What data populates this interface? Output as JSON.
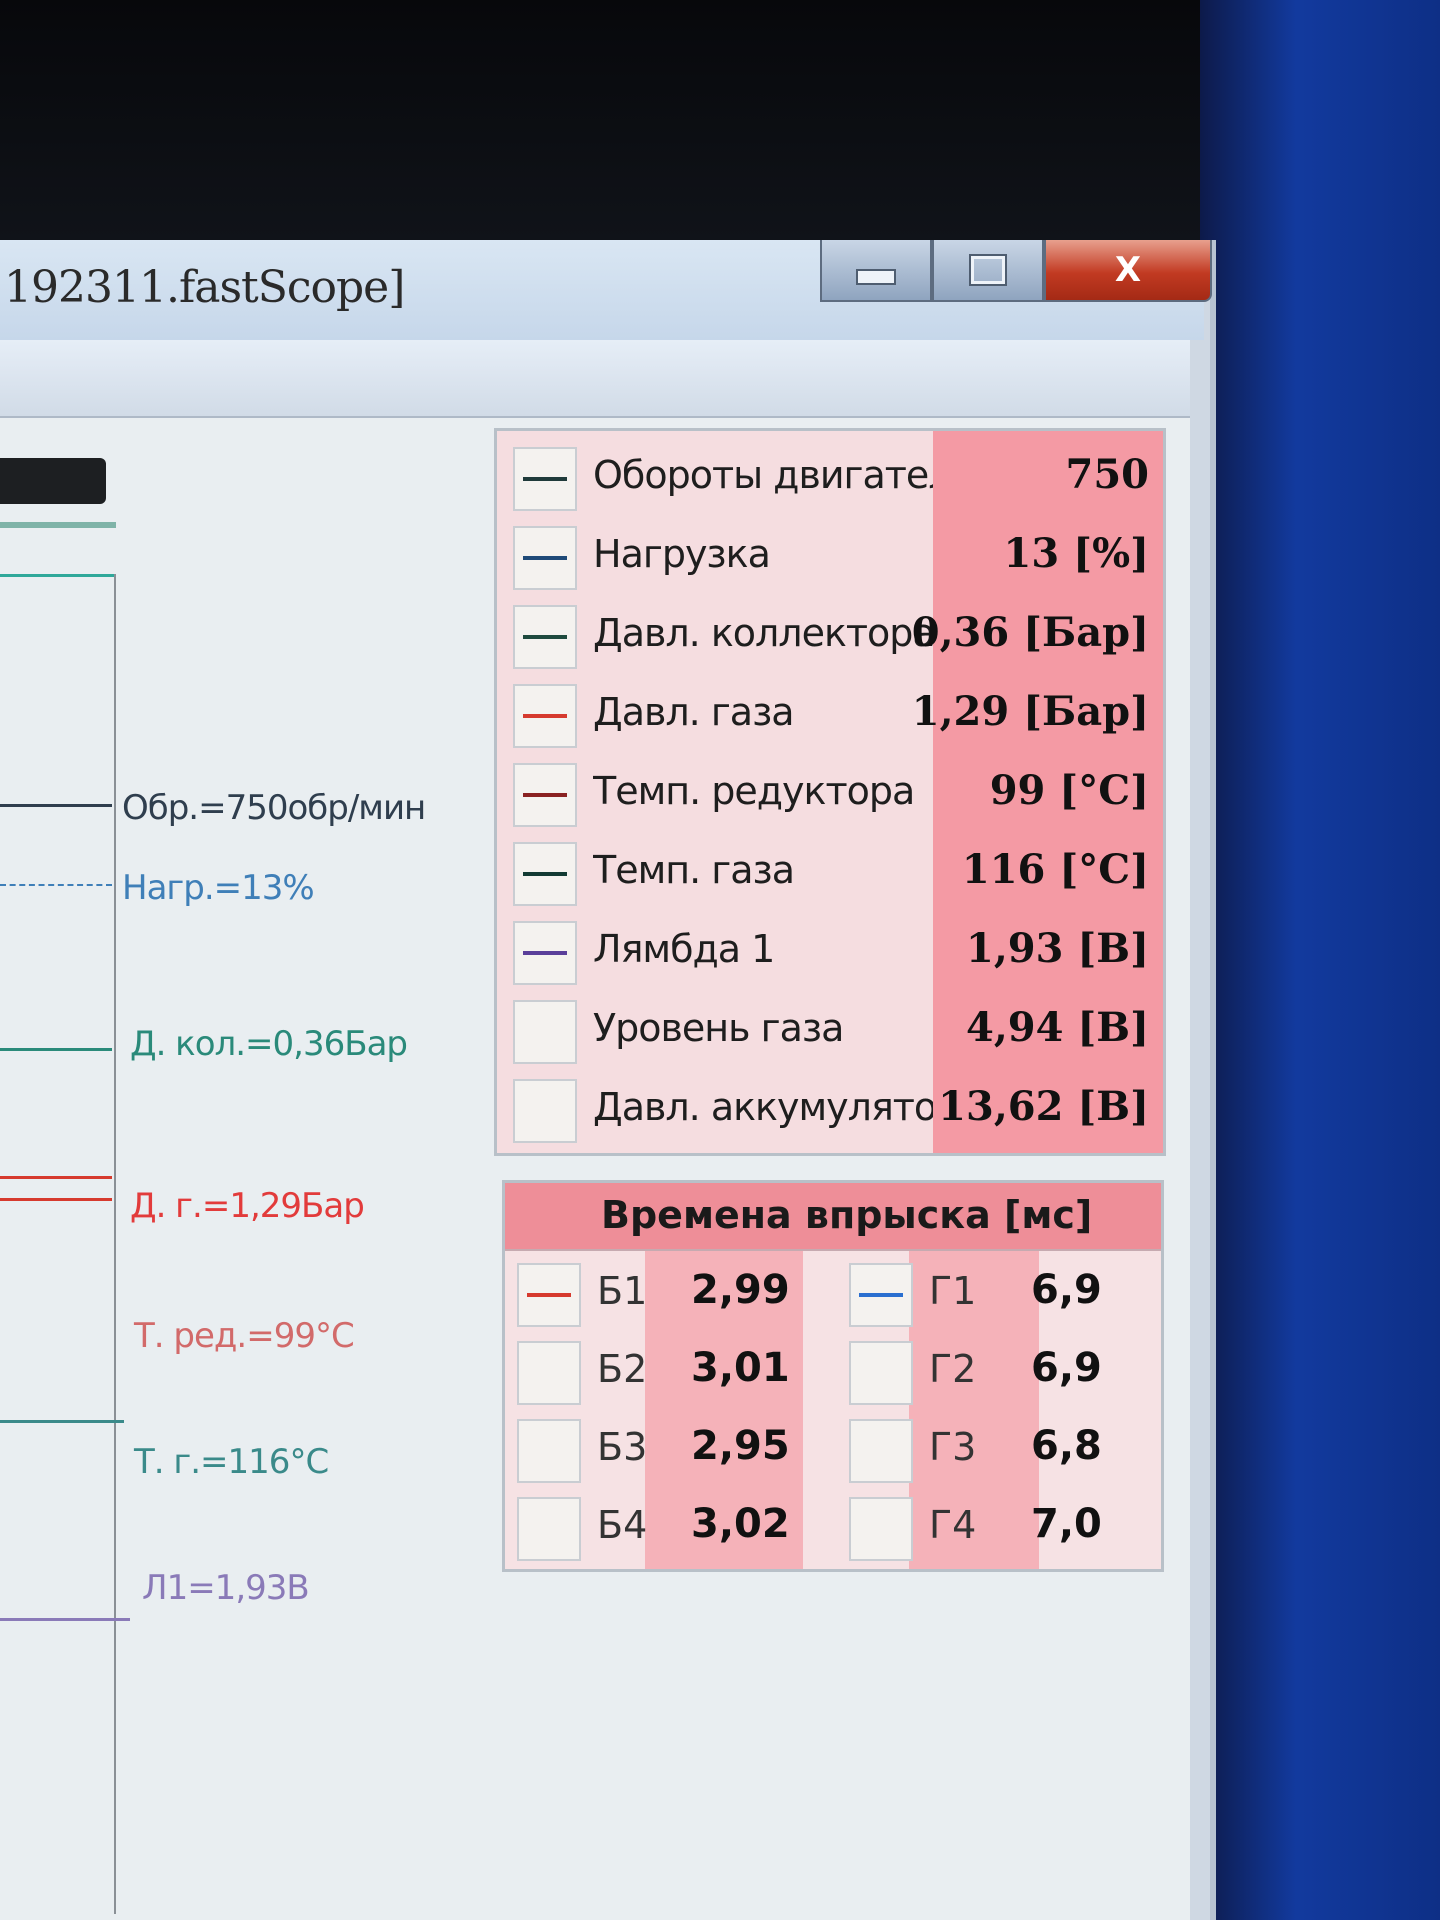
{
  "window": {
    "title": "192311.fastScope]",
    "buttons": {
      "minimize": "minimize",
      "maximize": "maximize",
      "close": "X"
    }
  },
  "scope": {
    "labels": [
      {
        "text": "Обр.=750обр/мин",
        "color": "#2f3e4e"
      },
      {
        "text": "Нагр.=13%",
        "color": "#3f7fb8"
      },
      {
        "text": "Д. кол.=0,36Бар",
        "color": "#2a8a7a"
      },
      {
        "text": "Д. г.=1,29Бар",
        "color": "#e23b3b"
      },
      {
        "text": "Т. ред.=99°С",
        "color": "#d26a6a"
      },
      {
        "text": "Т. г.=116°С",
        "color": "#3a8a8a"
      },
      {
        "text": "Л1=1,93В",
        "color": "#8a7ab8"
      }
    ]
  },
  "values": [
    {
      "label": "Обороты двигател",
      "value": "750",
      "line_color": "#1f3a3a"
    },
    {
      "label": "Нагрузка",
      "value": "13 [%]",
      "line_color": "#1f4a78"
    },
    {
      "label": "Давл. коллектора",
      "value": "0,36 [Бар]",
      "line_color": "#1e4a3e"
    },
    {
      "label": "Давл. газа",
      "value": "1,29 [Бар]",
      "line_color": "#d63a2e"
    },
    {
      "label": "Темп. редуктора",
      "value": "99 [°С]",
      "line_color": "#8a2222"
    },
    {
      "label": "Темп. газа",
      "value": "116 [°С]",
      "line_color": "#123a33"
    },
    {
      "label": "Лямбда 1",
      "value": "1,93 [В]",
      "line_color": "#5a3f9a"
    },
    {
      "label": "Уровень газа",
      "value": "4,94 [В]",
      "line_color": ""
    },
    {
      "label": "Давл. аккумулятог",
      "value": "13,62 [В]",
      "line_color": ""
    }
  ],
  "injection": {
    "title": "Времена впрыска [мс]",
    "rows": [
      {
        "b_label": "Б1",
        "b_value": "2,99",
        "b_color": "#d63a2e",
        "g_label": "Г1",
        "g_value": "6,9",
        "g_color": "#2a6fd0"
      },
      {
        "b_label": "Б2",
        "b_value": "3,01",
        "b_color": "",
        "g_label": "Г2",
        "g_value": "6,9",
        "g_color": ""
      },
      {
        "b_label": "Б3",
        "b_value": "2,95",
        "b_color": "",
        "g_label": "Г3",
        "g_value": "6,8",
        "g_color": ""
      },
      {
        "b_label": "Б4",
        "b_value": "3,02",
        "b_color": "",
        "g_label": "Г4",
        "g_value": "7,0",
        "g_color": ""
      }
    ]
  }
}
